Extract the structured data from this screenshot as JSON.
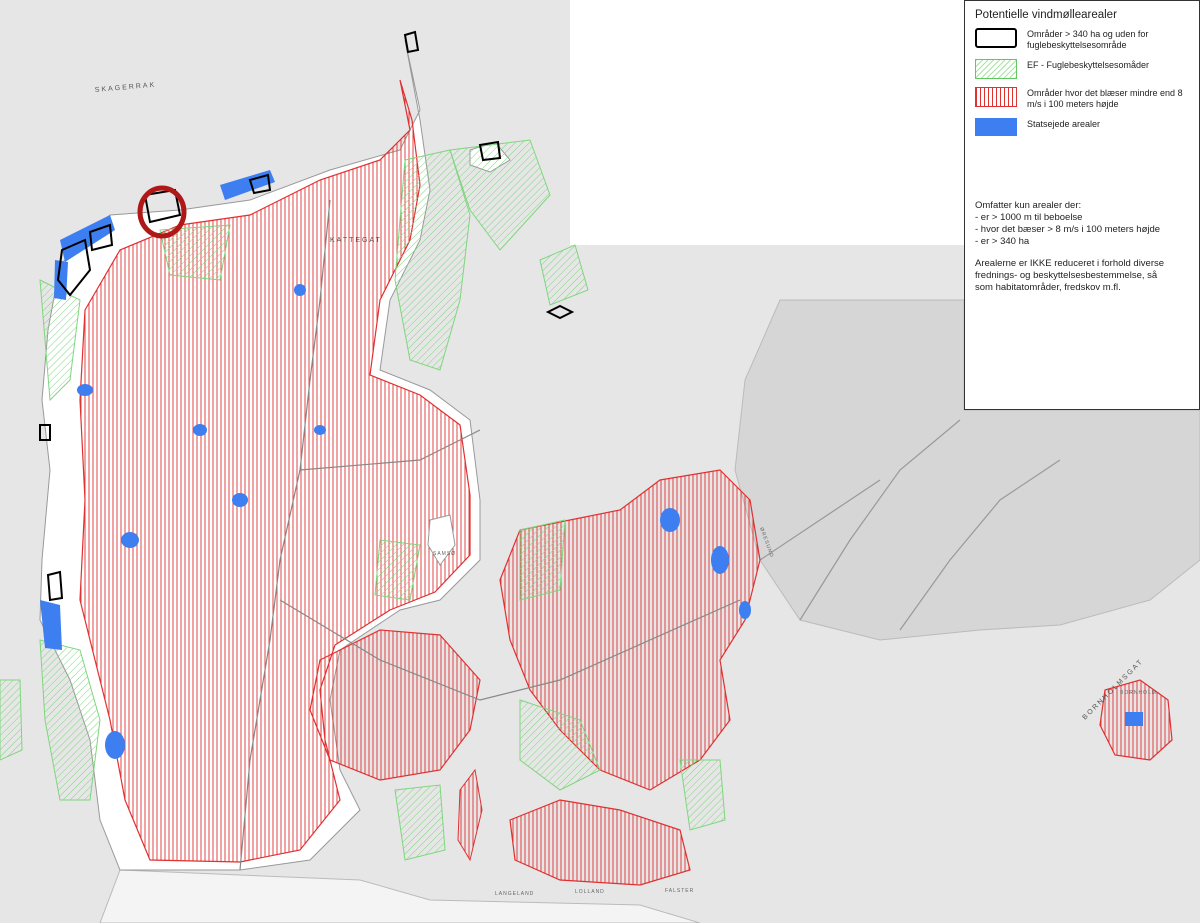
{
  "legend": {
    "title": "Potentielle vindmøllearealer",
    "items": [
      {
        "label": "Områder > 340 ha og uden for fuglebeskyttelsesområde",
        "swatch": "black-outline"
      },
      {
        "label": "EF - Fuglebeskyttelsesomåder",
        "swatch": "green-hatch"
      },
      {
        "label": "Områder hvor det blæser mindre end 8 m/s i 100 meters højde",
        "swatch": "red-hatch"
      },
      {
        "label": "Statsejede arealer",
        "swatch": "blue-fill"
      }
    ],
    "notes": [
      "Omfatter kun arealer der:",
      "- er > 1000 m til beboelse",
      "- hvor det bæser > 8 m/s i 100 meters højde",
      "- er > 340 ha",
      "",
      "Arealerne er IKKE reduceret i forhold diverse",
      "frednings- og beskyttelsesbestemmelse, så",
      "som habitatområder, fredskov m.fl."
    ]
  },
  "map_labels": {
    "skagerrak": "SKAGERRAK",
    "kattegat": "KATTEGAT",
    "bornholmsgat": "BORNHOLMSGAT",
    "bornholm": "BORNHOLM",
    "samso": "SAMSØ",
    "langeland": "LANGELAND",
    "falster": "FALSTER",
    "lolland": "LOLLAND",
    "oresund": "ØRESUND"
  },
  "colors": {
    "land": "#ffffff",
    "sea": "#e6e6e6",
    "red_hatch": "#e03030",
    "green_hatch": "#7ed67e",
    "state_owned": "#3d7ef0",
    "outline": "#000000",
    "highlight_circle": "#b01818",
    "sweden": "#d9d9d9"
  },
  "icons": [
    "highlight-circle-icon",
    "legend-black-outline-icon",
    "legend-green-hatch-icon",
    "legend-red-hatch-icon",
    "legend-blue-fill-icon"
  ]
}
